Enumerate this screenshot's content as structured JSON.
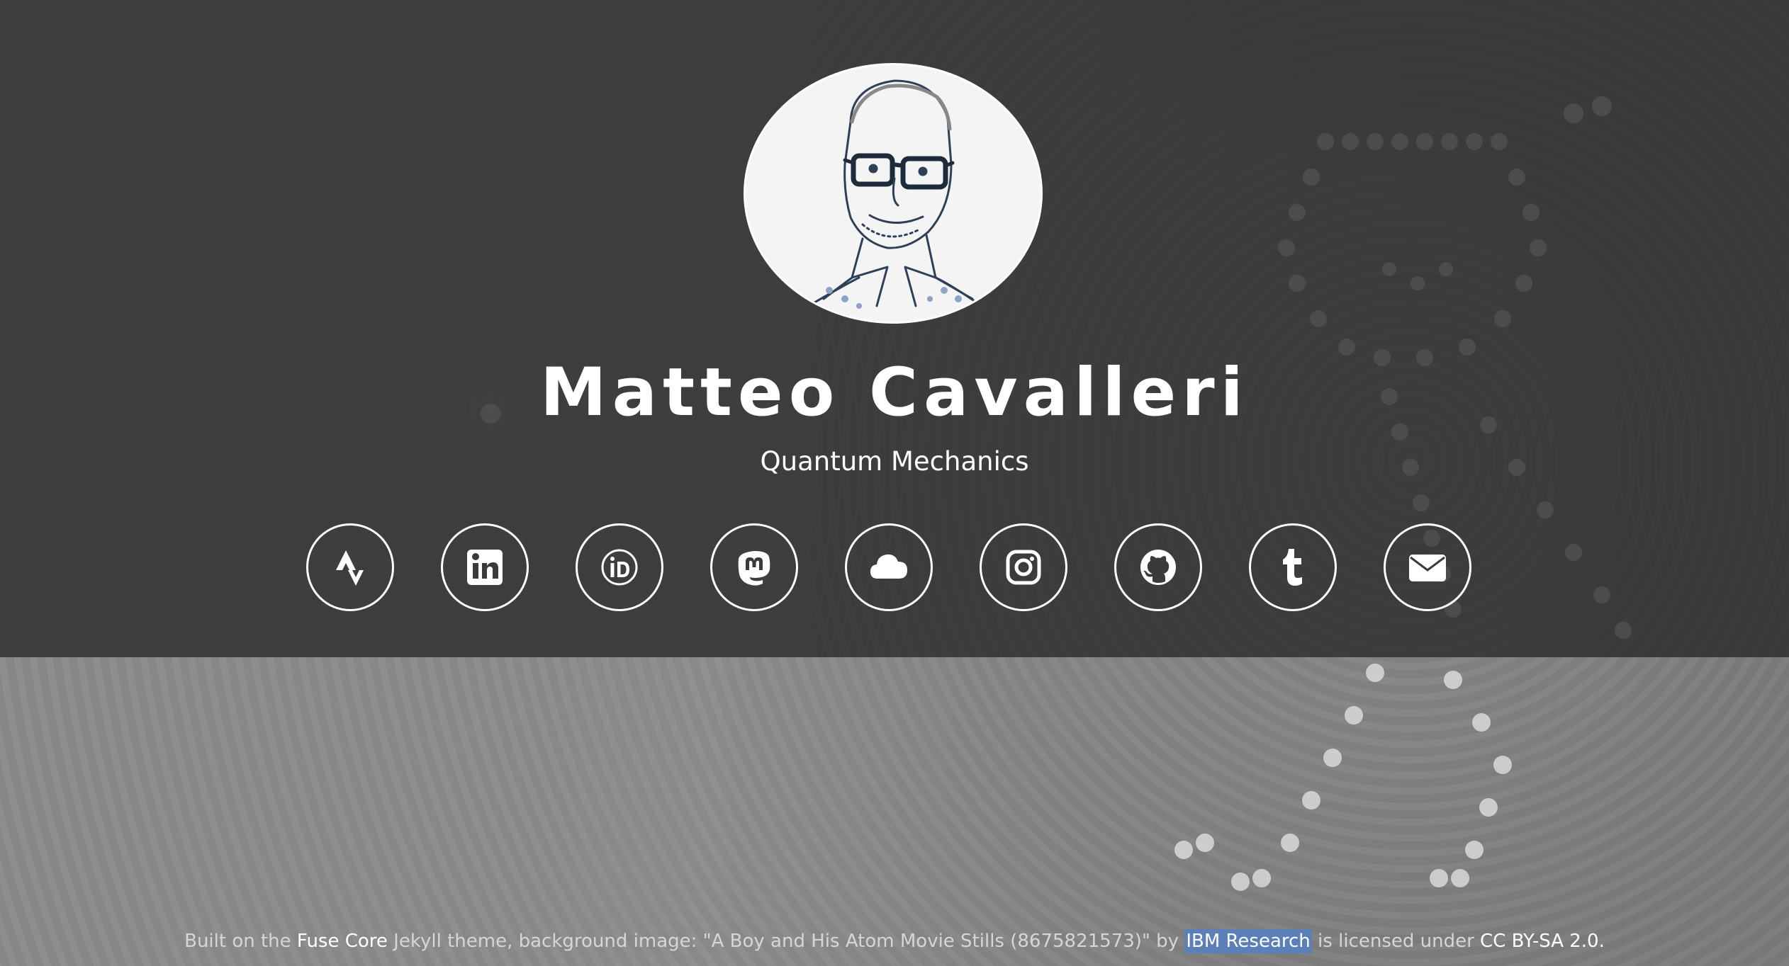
{
  "profile": {
    "name": "Matteo Cavalleri",
    "subtitle": "Quantum Mechanics"
  },
  "social_links": [
    {
      "icon": "strava-icon",
      "name": "social-strava-button"
    },
    {
      "icon": "linkedin-icon",
      "name": "social-linkedin-button"
    },
    {
      "icon": "orcid-icon",
      "name": "social-orcid-button"
    },
    {
      "icon": "mastodon-icon",
      "name": "social-mastodon-button"
    },
    {
      "icon": "cloud-icon",
      "name": "social-cloud-button"
    },
    {
      "icon": "instagram-icon",
      "name": "social-instagram-button"
    },
    {
      "icon": "github-icon",
      "name": "social-github-button"
    },
    {
      "icon": "tumblr-icon",
      "name": "social-tumblr-button"
    },
    {
      "icon": "envelope-icon",
      "name": "social-email-button"
    }
  ],
  "footer": {
    "prefix": "Built on the ",
    "theme_link": "Fuse Core",
    "middle": " Jekyll theme, background image: \"A Boy and His Atom Movie Stills (8675821573)\" by ",
    "author_link": "IBM Research",
    "license_text": " is licensed under ",
    "license_link": "CC BY-SA 2.0."
  },
  "colors": {
    "header_overlay": "#282828",
    "text": "#ffffff",
    "footer_text": "#d6d6d6",
    "selection": "#5b7fb8"
  }
}
